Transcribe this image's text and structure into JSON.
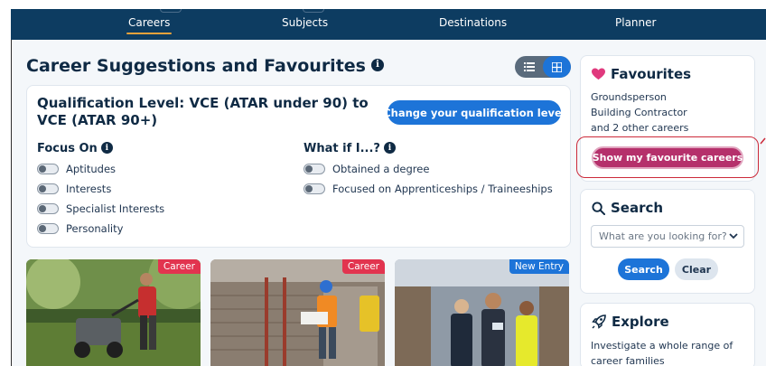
{
  "nav": {
    "items": [
      {
        "label": "Careers",
        "active": true
      },
      {
        "label": "Subjects",
        "active": false
      },
      {
        "label": "Destinations",
        "active": false
      },
      {
        "label": "Planner",
        "active": false
      }
    ]
  },
  "main": {
    "title": "Career Suggestions and Favourites",
    "info_glyph": "i",
    "view_toggle": {
      "selected": "grid"
    }
  },
  "filters": {
    "qualification_title": "Qualification Level: VCE (ATAR under 90) to VCE (ATAR 90+)",
    "change_button": "Change your qualification level",
    "focus_on": {
      "title": "Focus On",
      "options": [
        "Aptitudes",
        "Interests",
        "Specialist Interests",
        "Personality"
      ]
    },
    "what_if": {
      "title": "What if I...?",
      "options": [
        "Obtained a degree",
        "Focused on Apprenticeships / Traineeships"
      ]
    }
  },
  "cards": [
    {
      "badge": "Career",
      "badge_color": "#e2344f"
    },
    {
      "badge": "Career",
      "badge_color": "#e2344f"
    },
    {
      "badge": "New Entry",
      "badge_color": "#1d74d8"
    }
  ],
  "favourites": {
    "title": "Favourites",
    "items": [
      "Groundsperson",
      "Building Contractor",
      "and 2 other careers"
    ],
    "button": "Show my favourite careers"
  },
  "search": {
    "title": "Search",
    "placeholder": "What are you looking for?",
    "search_button": "Search",
    "clear_button": "Clear"
  },
  "explore": {
    "title": "Explore",
    "lines": [
      "Investigate a whole range of",
      "career families"
    ]
  },
  "colors": {
    "nav_bg": "#0d3c61",
    "accent_blue": "#1d74d8",
    "favourite_pink": "#b5306b",
    "heart": "#e0397d",
    "highlight_red": "#cc2a3a"
  }
}
